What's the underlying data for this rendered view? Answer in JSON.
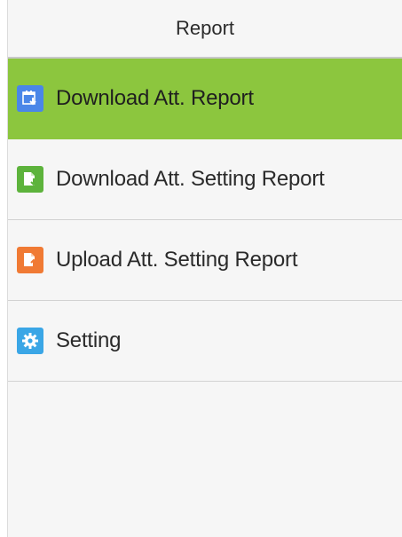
{
  "header": {
    "title": "Report"
  },
  "menu": {
    "items": [
      {
        "label": "Download Att. Report",
        "icon": "calendar-download-icon",
        "color": "#4a86e8",
        "selected": true
      },
      {
        "label": "Download Att. Setting Report",
        "icon": "document-download-icon",
        "color": "#5db33c",
        "selected": false
      },
      {
        "label": "Upload Att. Setting Report",
        "icon": "document-upload-icon",
        "color": "#f07a34",
        "selected": false
      },
      {
        "label": "Setting",
        "icon": "gear-icon",
        "color": "#3aa6e6",
        "selected": false
      }
    ]
  },
  "colors": {
    "selected_background": "#8cc63e",
    "background": "#f6f6f6"
  }
}
